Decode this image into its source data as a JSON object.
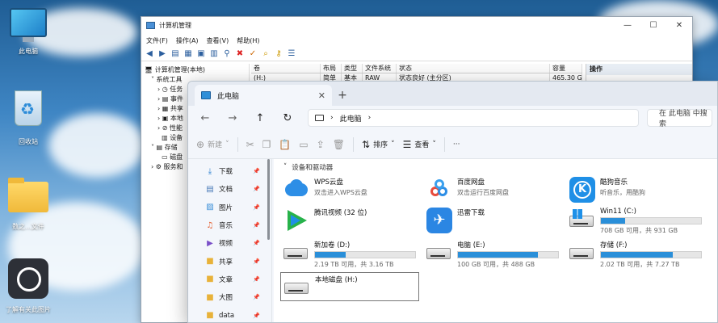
{
  "desktop": {
    "icons": [
      {
        "label": "此电脑"
      },
      {
        "label": "回收站"
      },
      {
        "label": "数之...文件"
      },
      {
        "label": "了解有关此图片"
      }
    ]
  },
  "computer_management": {
    "title": "计算机管理",
    "window_buttons": [
      "—",
      "☐",
      "✕"
    ],
    "menu": [
      "文件(F)",
      "操作(A)",
      "查看(V)",
      "帮助(H)"
    ],
    "tree": [
      "计算机管理(本地)",
      "系统工具",
      "任务",
      "事件",
      "共享",
      "本地",
      "性能",
      "设备",
      "存储",
      "磁盘",
      "服务和"
    ],
    "columns": [
      "卷",
      "布局",
      "类型",
      "文件系统",
      "状态",
      "容量"
    ],
    "row": [
      "(H:)",
      "简单",
      "基本",
      "RAW",
      "状态良好 (主分区)",
      "465.30 G"
    ],
    "actions_header": "操作"
  },
  "explorer": {
    "tab_label": "此电脑",
    "tab_close": "✕",
    "tab_add": "+",
    "breadcrumb": "此电脑",
    "search_placeholder": "在 此电脑 中搜索",
    "commands": {
      "new": "新建",
      "sort": "排序",
      "view": "查看",
      "more": "···"
    },
    "sidebar": [
      {
        "label": "下载",
        "icon": "download-icon"
      },
      {
        "label": "文档",
        "icon": "document-icon"
      },
      {
        "label": "图片",
        "icon": "picture-icon"
      },
      {
        "label": "音乐",
        "icon": "music-icon"
      },
      {
        "label": "视频",
        "icon": "video-icon"
      },
      {
        "label": "共享",
        "icon": "folder-icon"
      },
      {
        "label": "文章",
        "icon": "folder-icon"
      },
      {
        "label": "大图",
        "icon": "folder-icon"
      },
      {
        "label": "data",
        "icon": "folder-icon"
      }
    ],
    "group_title": "设备和驱动器",
    "items": [
      {
        "name": "WPS云盘",
        "sub": "双击进入WPS云盘",
        "kind": "app"
      },
      {
        "name": "百度网盘",
        "sub": "双击运行百度网盘",
        "kind": "app"
      },
      {
        "name": "酷狗音乐",
        "sub": "听音乐，用酷狗",
        "kind": "app"
      },
      {
        "name": "腾讯视频 (32 位)",
        "sub": "",
        "kind": "app"
      },
      {
        "name": "迅雷下载",
        "sub": "",
        "kind": "app"
      },
      {
        "name": "Win11 (C:)",
        "sub": "708 GB 可用，共 931 GB",
        "kind": "drive",
        "used_fraction": 0.24
      },
      {
        "name": "新加卷 (D:)",
        "sub": "2.19 TB 可用，共 3.16 TB",
        "kind": "drive",
        "used_fraction": 0.31
      },
      {
        "name": "电脑 (E:)",
        "sub": "100 GB 可用，共 488 GB",
        "kind": "drive",
        "used_fraction": 0.8
      },
      {
        "name": "存储 (F:)",
        "sub": "2.02 TB 可用，共 7.27 TB",
        "kind": "drive",
        "used_fraction": 0.72
      },
      {
        "name": "本地磁盘 (H:)",
        "sub": "",
        "kind": "drive"
      }
    ]
  }
}
